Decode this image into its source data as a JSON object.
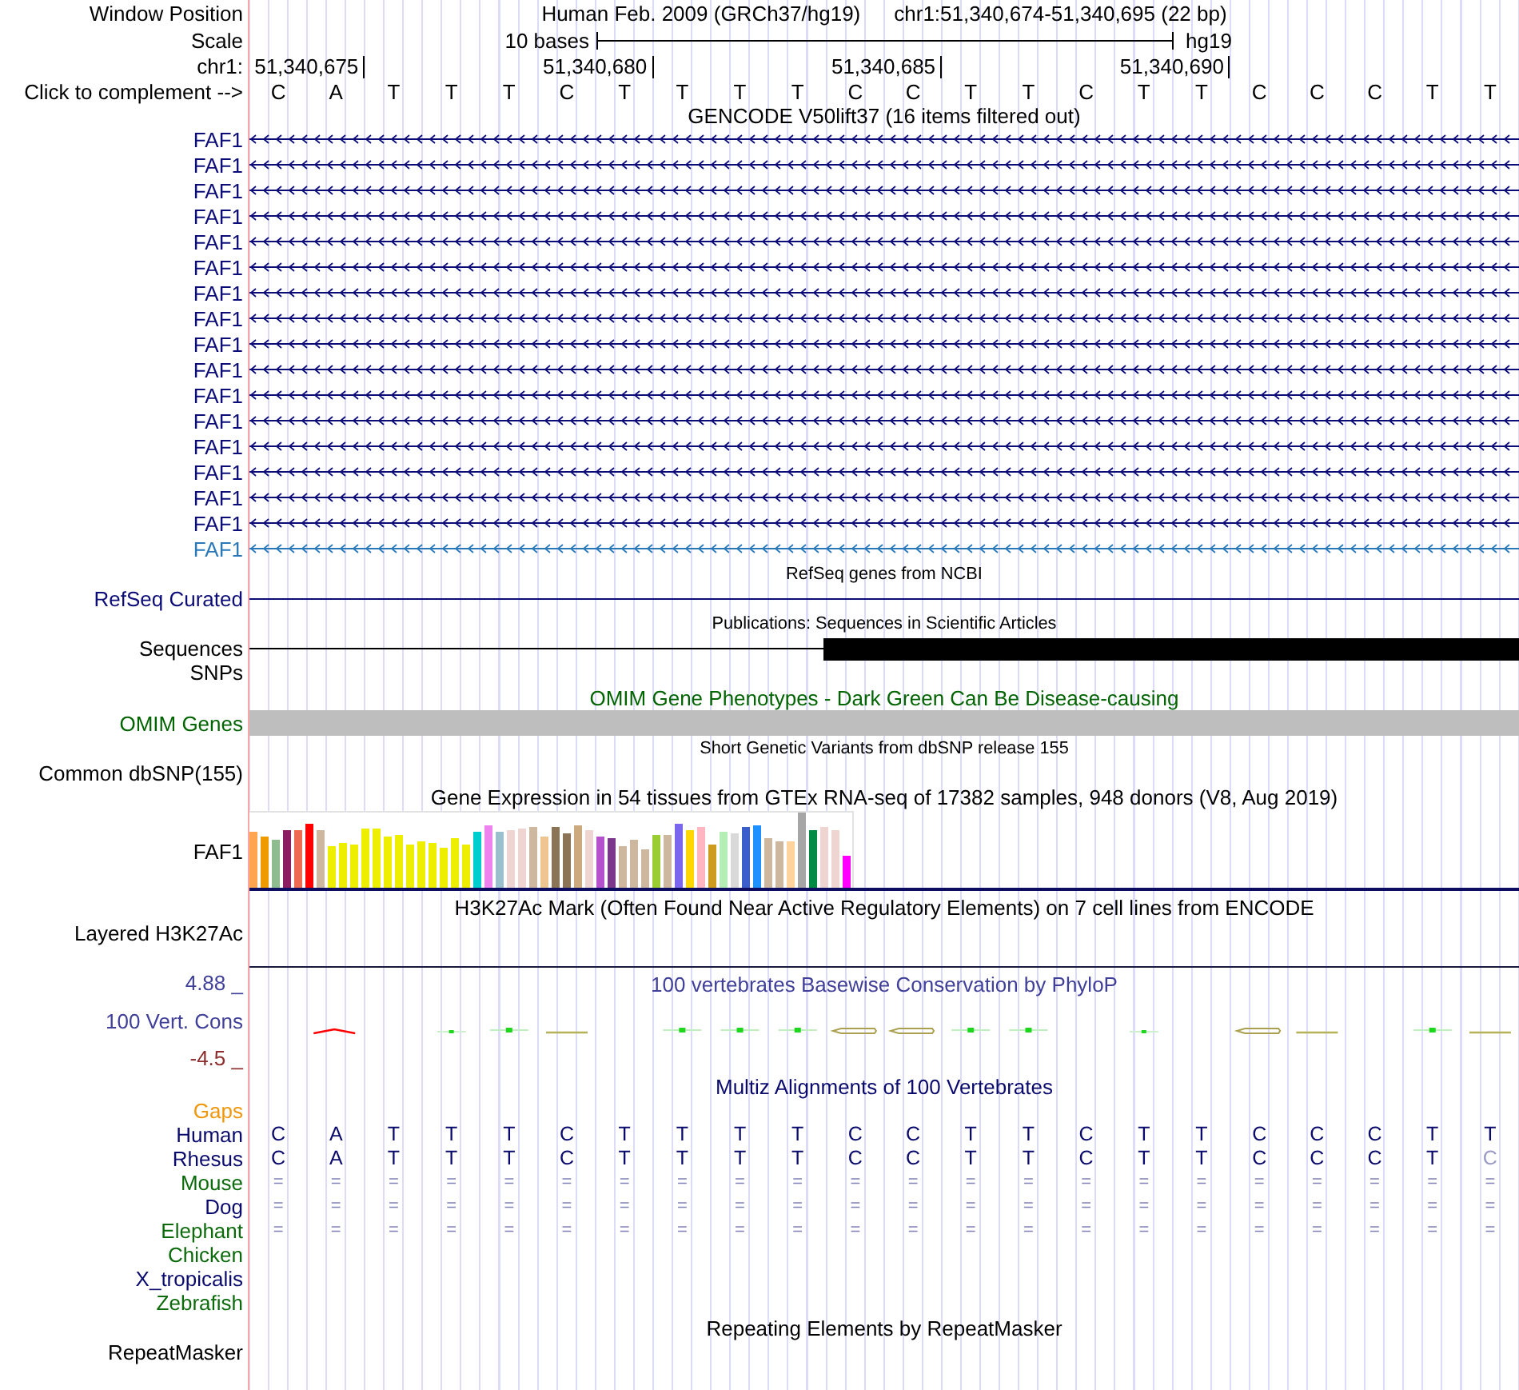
{
  "position_bar": {
    "label": "Window Position",
    "assembly": "Human Feb. 2009 (GRCh37/hg19)",
    "range": "chr1:51,340,674-51,340,695 (22 bp)"
  },
  "scale": {
    "label": "Scale",
    "span": "10 bases",
    "assembly": "hg19"
  },
  "ruler": {
    "label": "chr1:",
    "ticks": [
      "51,340,675",
      "51,340,680",
      "51,340,685",
      "51,340,690"
    ]
  },
  "sequence": {
    "label": "Click to complement -->",
    "bases": [
      "C",
      "A",
      "T",
      "T",
      "T",
      "C",
      "T",
      "T",
      "T",
      "T",
      "C",
      "C",
      "T",
      "T",
      "C",
      "T",
      "T",
      "C",
      "C",
      "C",
      "T",
      "T"
    ]
  },
  "tracks": [
    {
      "kind": "genes",
      "title": "GENCODE V50lift37 (16 items filtered out)",
      "items": [
        {
          "label": "FAF1",
          "color": "#0c0c78"
        },
        {
          "label": "FAF1",
          "color": "#0c0c78"
        },
        {
          "label": "FAF1",
          "color": "#0c0c78"
        },
        {
          "label": "FAF1",
          "color": "#0c0c78"
        },
        {
          "label": "FAF1",
          "color": "#0c0c78"
        },
        {
          "label": "FAF1",
          "color": "#0c0c78"
        },
        {
          "label": "FAF1",
          "color": "#0c0c78"
        },
        {
          "label": "FAF1",
          "color": "#0c0c78"
        },
        {
          "label": "FAF1",
          "color": "#0c0c78"
        },
        {
          "label": "FAF1",
          "color": "#0c0c78"
        },
        {
          "label": "FAF1",
          "color": "#0c0c78"
        },
        {
          "label": "FAF1",
          "color": "#0c0c78"
        },
        {
          "label": "FAF1",
          "color": "#0c0c78"
        },
        {
          "label": "FAF1",
          "color": "#0c0c78"
        },
        {
          "label": "FAF1",
          "color": "#0c0c78"
        },
        {
          "label": "FAF1",
          "color": "#0c0c78"
        },
        {
          "label": "FAF1",
          "color": "#2a78b8"
        }
      ]
    },
    {
      "kind": "line",
      "title": "RefSeq genes from NCBI",
      "label": "RefSeq Curated",
      "color": "#0c0c78"
    },
    {
      "kind": "publications",
      "title": "Publications: Sequences in Scientific Articles",
      "labels": [
        "Sequences",
        "SNPs"
      ]
    },
    {
      "kind": "bar",
      "title": "OMIM Gene Phenotypes - Dark Green Can Be Disease-causing",
      "label": "OMIM Genes",
      "color": "#006400"
    },
    {
      "kind": "variants",
      "title": "Short Genetic Variants from dbSNP release 155",
      "label": "Common dbSNP(155)"
    },
    {
      "kind": "expression",
      "title": "Gene Expression in 54 tissues from GTEx RNA-seq of 17382 samples, 948 donors (V8, Aug 2019)",
      "label": "FAF1"
    },
    {
      "kind": "signal",
      "title": "H3K27Ac Mark (Often Found Near Active Regulatory Elements) on 7 cell lines from ENCODE",
      "label": "Layered H3K27Ac"
    },
    {
      "kind": "conservation",
      "title": "100 vertebrates Basewise Conservation by PhyloP",
      "label": "100 Vert. Cons",
      "max": "4.88 _",
      "min": "-4.5 _",
      "color": "#40409a"
    },
    {
      "kind": "alignment",
      "title": "Multiz Alignments of 100 Vertebrates",
      "color": "#0a0a6e",
      "rows": [
        {
          "species": "Gaps",
          "color": "#f0960a",
          "kind": "empty"
        },
        {
          "species": "Human",
          "color": "#0a0a6e",
          "kind": "sequence",
          "bases": [
            "C",
            "A",
            "T",
            "T",
            "T",
            "C",
            "T",
            "T",
            "T",
            "T",
            "C",
            "C",
            "T",
            "T",
            "C",
            "T",
            "T",
            "C",
            "C",
            "C",
            "T",
            "T"
          ]
        },
        {
          "species": "Rhesus",
          "color": "#0a0a6e",
          "kind": "sequence",
          "bases": [
            {
              "base": "C",
              "faded": false
            },
            {
              "base": "A",
              "faded": false
            },
            {
              "base": "T",
              "faded": false
            },
            {
              "base": "T",
              "faded": false
            },
            {
              "base": "T",
              "faded": false
            },
            {
              "base": "C",
              "faded": false
            },
            {
              "base": "T",
              "faded": false
            },
            {
              "base": "T",
              "faded": false
            },
            {
              "base": "T",
              "faded": false
            },
            {
              "base": "T",
              "faded": false
            },
            {
              "base": "C",
              "faded": false
            },
            {
              "base": "C",
              "faded": false
            },
            {
              "base": "T",
              "faded": false
            },
            {
              "base": "T",
              "faded": false
            },
            {
              "base": "C",
              "faded": false
            },
            {
              "base": "T",
              "faded": false
            },
            {
              "base": "T",
              "faded": false
            },
            {
              "base": "C",
              "faded": false
            },
            {
              "base": "C",
              "faded": false
            },
            {
              "base": "C",
              "faded": false
            },
            {
              "base": "T",
              "faded": false
            },
            {
              "base": "C",
              "faded": true
            }
          ]
        },
        {
          "species": "Mouse",
          "color": "#0b6b0b",
          "kind": "match",
          "bases": [
            "=",
            "=",
            "=",
            "=",
            "=",
            "=",
            "=",
            "=",
            "=",
            "=",
            "=",
            "=",
            "=",
            "=",
            "=",
            "=",
            "=",
            "=",
            "=",
            "=",
            "=",
            "="
          ]
        },
        {
          "species": "Dog",
          "color": "#0a0a6e",
          "kind": "match",
          "bases": [
            "=",
            "=",
            "=",
            "=",
            "=",
            "=",
            "=",
            "=",
            "=",
            "=",
            "=",
            "=",
            "=",
            "=",
            "=",
            "=",
            "=",
            "=",
            "=",
            "=",
            "=",
            "="
          ]
        },
        {
          "species": "Elephant",
          "color": "#0b6b0b",
          "kind": "match",
          "bases": [
            "=",
            "=",
            "=",
            "=",
            "=",
            "=",
            "=",
            "=",
            "=",
            "=",
            "=",
            "=",
            "=",
            "=",
            "=",
            "=",
            "=",
            "=",
            "=",
            "=",
            "=",
            "="
          ]
        },
        {
          "species": "Chicken",
          "color": "#0b6b0b",
          "kind": "empty"
        },
        {
          "species": "X_tropicalis",
          "color": "#0a0a6e",
          "kind": "empty"
        },
        {
          "species": "Zebrafish",
          "color": "#0b6b0b",
          "kind": "empty"
        }
      ]
    },
    {
      "kind": "repeats",
      "title": "Repeating Elements by RepeatMasker",
      "label": "RepeatMasker"
    }
  ]
}
